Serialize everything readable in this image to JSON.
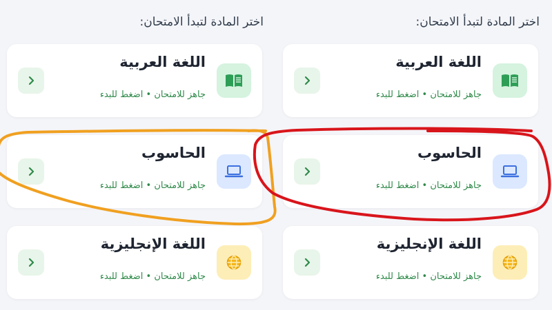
{
  "panels": [
    {
      "heading": "اختر المادة لتبدأ الامتحان:",
      "cards": [
        {
          "title": "اللغة العربية",
          "subtitle": "جاهز للامتحان • اضغط للبدء",
          "icon": "book-icon"
        },
        {
          "title": "الحاسوب",
          "subtitle": "جاهز للامتحان • اضغط للبدء",
          "icon": "laptop-icon"
        },
        {
          "title": "اللغة الإنجليزية",
          "subtitle": "جاهز للامتحان • اضغط للبدء",
          "icon": "globe-icon"
        }
      ]
    },
    {
      "heading": "اختر المادة لتبدأ الامتحان:",
      "cards": [
        {
          "title": "اللغة العربية",
          "subtitle": "جاهز للامتحان • اضغط للبدء",
          "icon": "book-icon"
        },
        {
          "title": "الحاسوب",
          "subtitle": "جاهز للامتحان • اضغط للبدء",
          "icon": "laptop-icon"
        },
        {
          "title": "اللغة الإنجليزية",
          "subtitle": "جاهز للامتحان • اضغط للبدء",
          "icon": "globe-icon"
        }
      ]
    }
  ],
  "colors": {
    "accent_green": "#2f8a4a",
    "highlight_orange": "#f0a020",
    "highlight_red": "#d8151b"
  }
}
